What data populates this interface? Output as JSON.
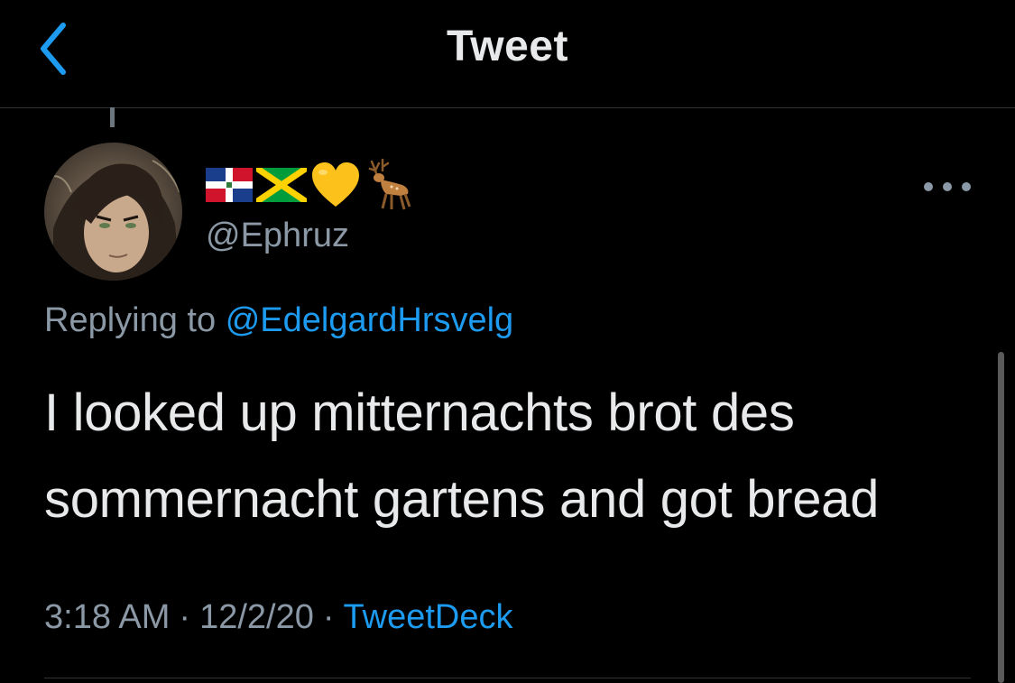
{
  "header": {
    "title": "Tweet",
    "back_icon": "chevron-left-icon"
  },
  "tweet": {
    "author": {
      "display_name_emoji": [
        "flag-dominican-republic-icon",
        "flag-jamaica-icon",
        "yellow-heart-icon",
        "deer-icon"
      ],
      "handle": "@Ephruz"
    },
    "replying_prefix": "Replying to",
    "replying_to": "@EdelgardHrsvelg",
    "text": "I looked up mitternachts brot des sommernacht gartens and got bread",
    "time": "3:18 AM",
    "date": "12/2/20",
    "separator": "·",
    "source": "TweetDeck"
  },
  "colors": {
    "background": "#000000",
    "accent": "#1d9bf0",
    "muted": "#8b98a5",
    "text": "#e7e9ea"
  }
}
